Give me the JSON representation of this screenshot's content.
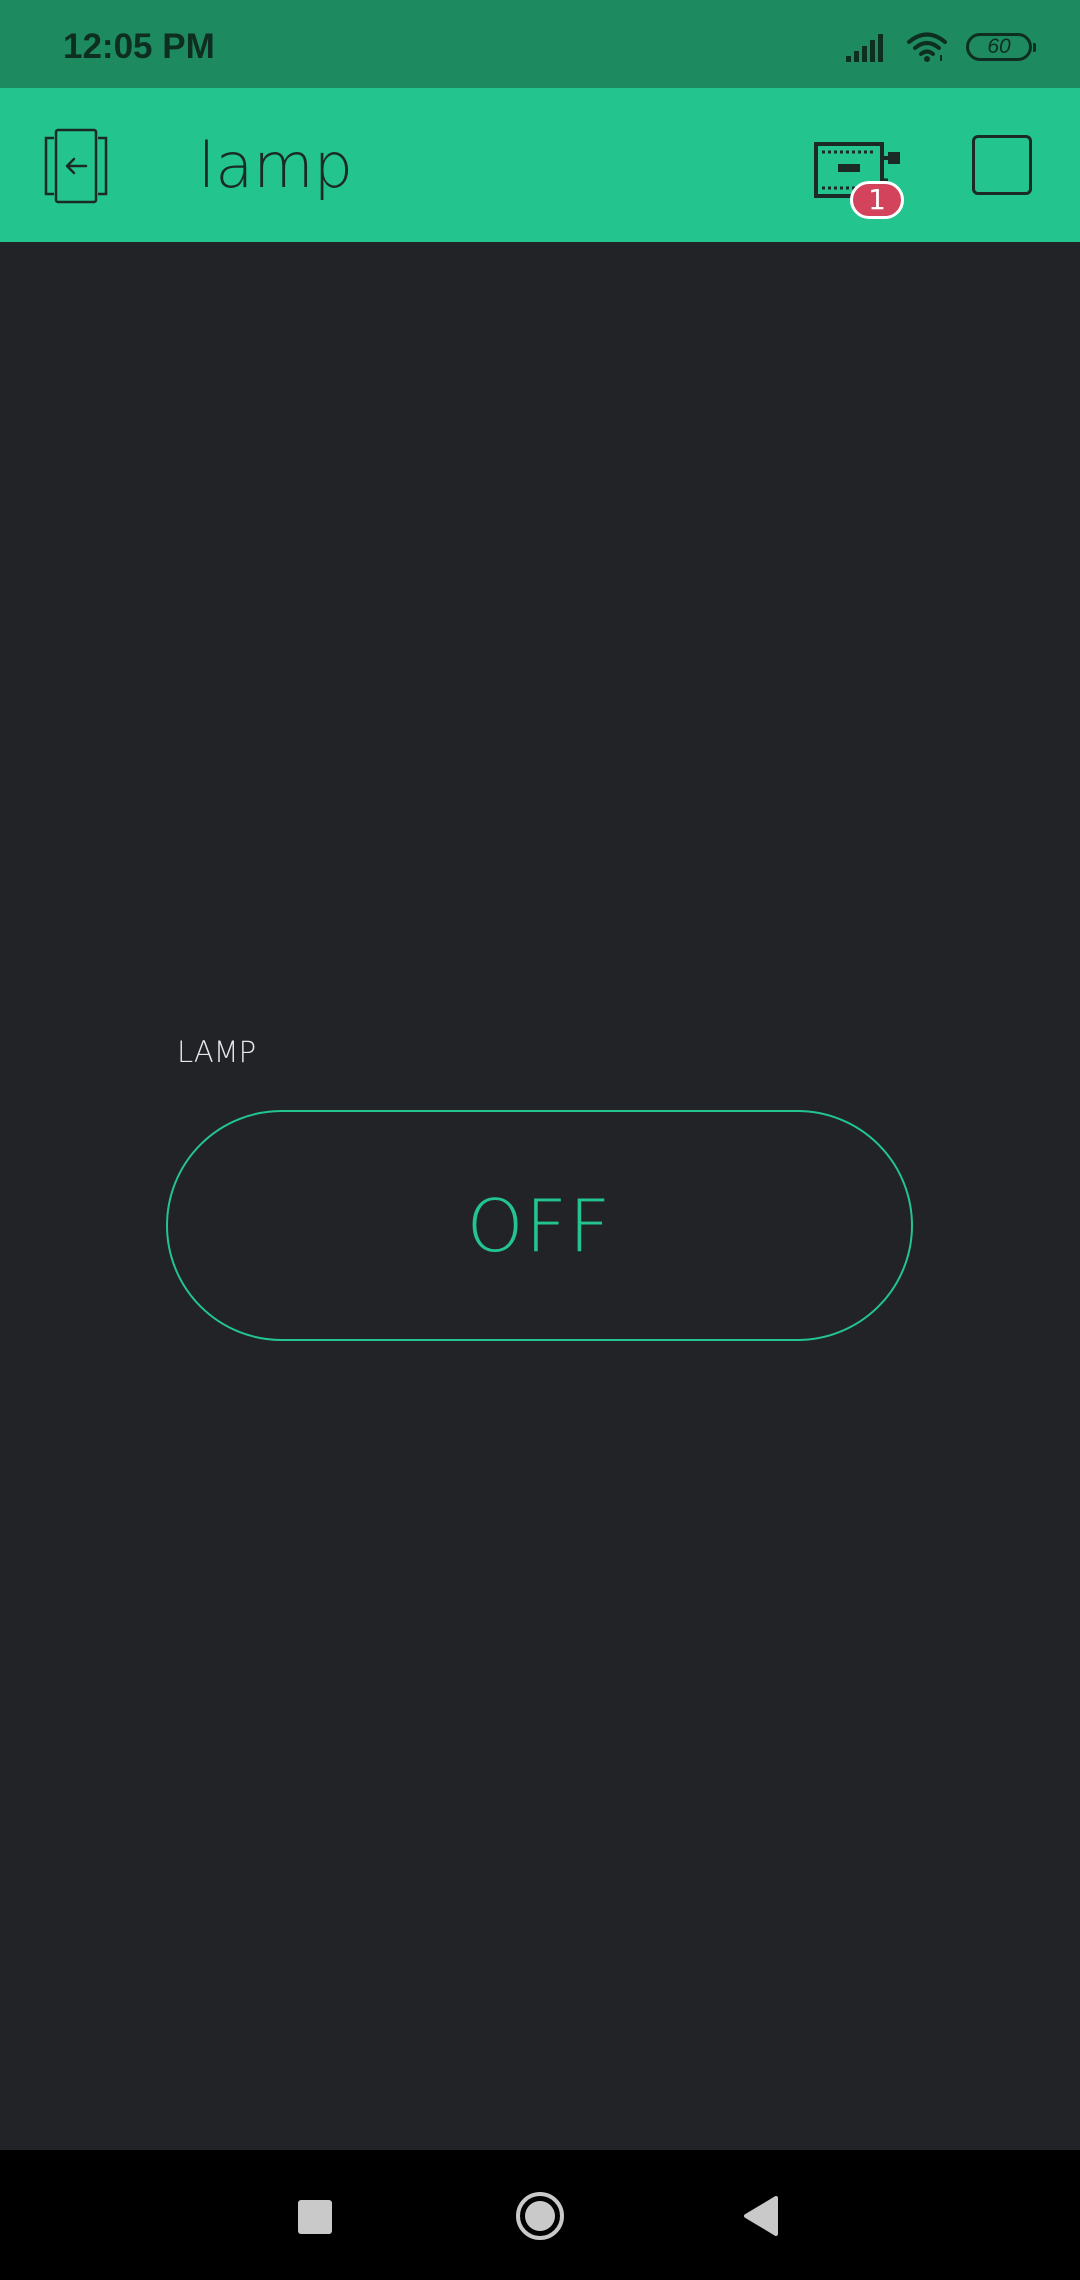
{
  "status_bar": {
    "time": "12:05 PM",
    "battery": "60",
    "icons": [
      "signal-icon",
      "wifi-icon",
      "battery-icon"
    ]
  },
  "app_bar": {
    "title": "lamp",
    "back_icon": "exit-icon",
    "device_icon": "device-board-icon",
    "device_badge": "1",
    "stop_icon": "stop-icon"
  },
  "widget": {
    "label": "LAMP",
    "state": "OFF"
  },
  "nav_bar": {
    "icons": [
      "recents-icon",
      "home-icon",
      "back-icon"
    ]
  },
  "colors": {
    "status_bar": "#1e8a5f",
    "app_bar": "#23c48e",
    "background": "#212327",
    "accent": "#23c48e",
    "badge": "#d3435c"
  }
}
